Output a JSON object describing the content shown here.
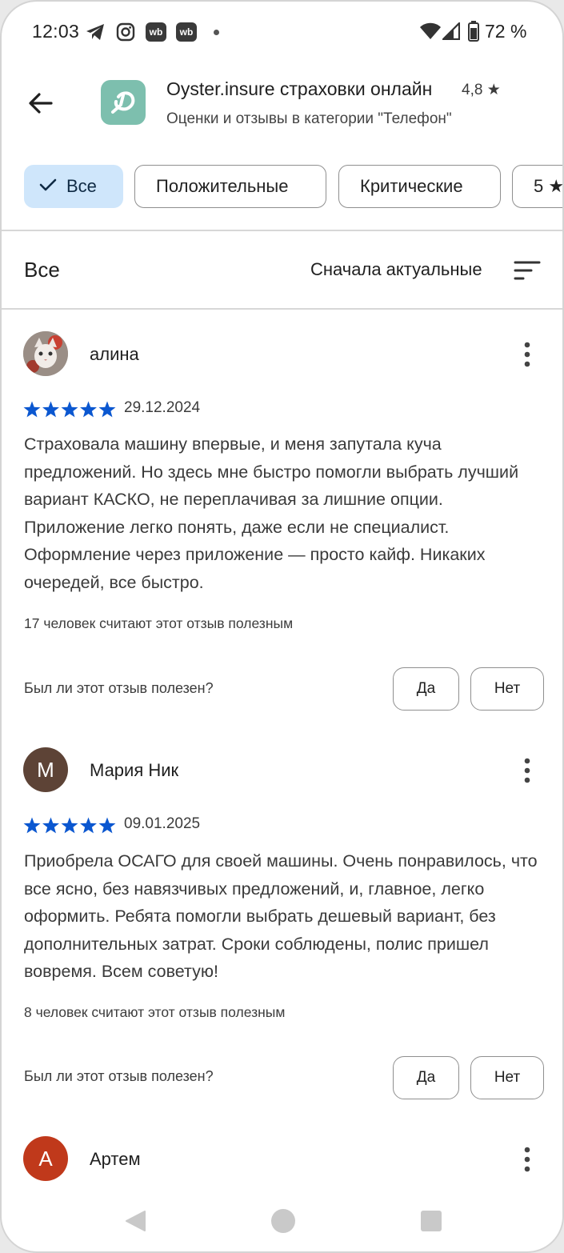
{
  "status_bar": {
    "time": "12:03",
    "notification_icons": [
      "telegram-icon",
      "instagram-icon",
      "wb-icon",
      "wb-icon"
    ],
    "wb_label": "wb",
    "battery_percent": "72 %"
  },
  "header": {
    "app_name": "Oyster.insure страховки онлайн",
    "rating": "4,8",
    "subtitle": "Оценки и отзывы в категории \"Телефон\"",
    "accent_color": "#7dbfae"
  },
  "filters": {
    "chips": [
      {
        "label": "Все",
        "selected": true
      },
      {
        "label": "Положительные",
        "selected": false
      },
      {
        "label": "Критические",
        "selected": false
      },
      {
        "label": "5",
        "selected": false
      }
    ]
  },
  "sort_bar": {
    "label": "Все",
    "mode": "Сначала актуальные"
  },
  "reviews": [
    {
      "author": "алина",
      "avatar_type": "photo",
      "stars": 5,
      "date": "29.12.2024",
      "text": "Страховала машину впервые, и меня запутала куча предложений. Но здесь мне быстро помогли выбрать лучший вариант КАСКО, не переплачивая за лишние опции. Приложение легко понять, даже если не специалист. Оформление через приложение — просто кайф. Никаких очередей, все быстро.",
      "helpful_count": "17 человек считают этот отзыв полезным",
      "question": "Был ли этот отзыв полезен?",
      "yes_label": "Да",
      "no_label": "Нет"
    },
    {
      "author": "Мария Ник",
      "avatar_letter": "М",
      "avatar_color": "#5d4336",
      "stars": 5,
      "date": "09.01.2025",
      "text": "Приобрела ОСАГО для своей машины. Очень понравилось, что все ясно, без навязчивых предложений, и, главное, легко оформить. Ребята помогли выбрать дешевый вариант, без дополнительных затрат. Сроки соблюдены, полис пришел вовремя. Всем советую!",
      "helpful_count": "8 человек считают этот отзыв полезным",
      "question": "Был ли этот отзыв полезен?",
      "yes_label": "Да",
      "no_label": "Нет"
    },
    {
      "author": "Артем",
      "avatar_letter": "А",
      "avatar_color": "#c0391b"
    }
  ],
  "colors": {
    "star": "#0b57d0",
    "chip_selected_bg": "#cfe6fb"
  }
}
